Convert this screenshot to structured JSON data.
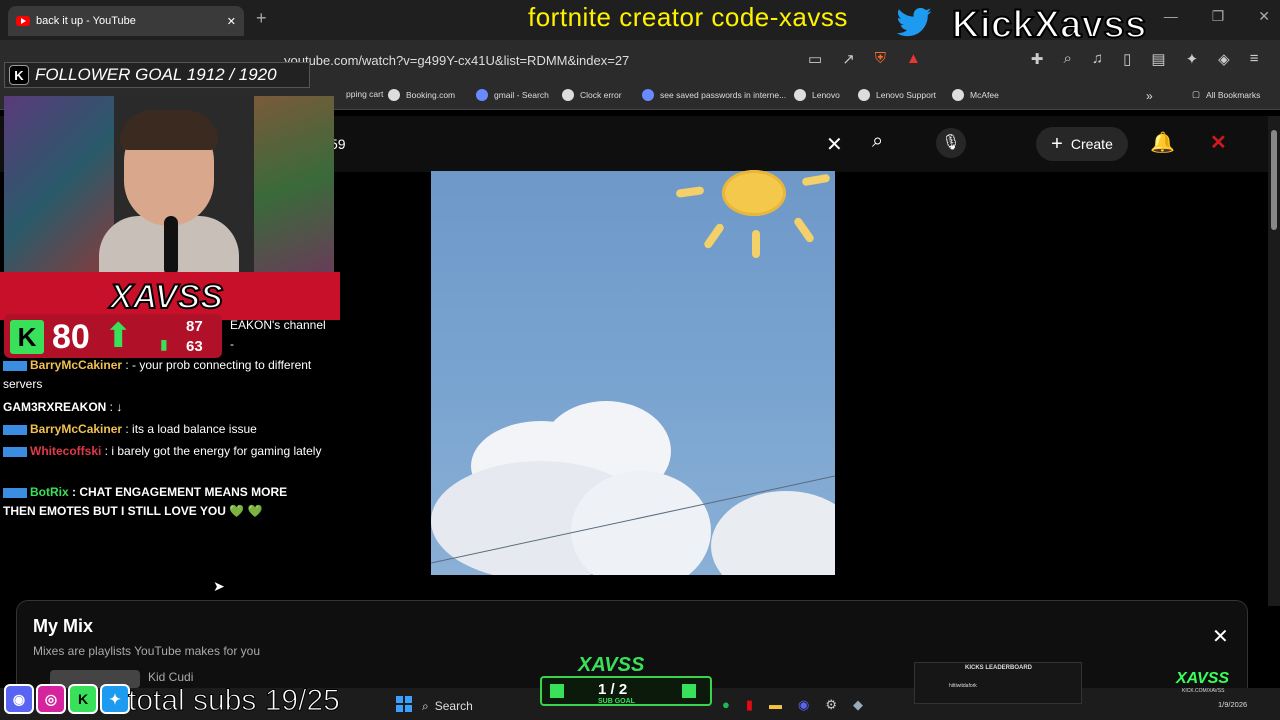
{
  "browser": {
    "tab_title": "back it up - YouTube",
    "new_tab": "+",
    "url": "youtube.com/watch?v=g499Y-cx41U&list=RDMM&index=27",
    "bookmarks": [
      "pping cart",
      "Booking.com",
      "gmail - Search",
      "Clock error",
      "see saved passwords in interne...",
      "Lenovo",
      "Lenovo Support",
      "McAfee"
    ],
    "all_bookmarks": "All Bookmarks",
    "window_controls": [
      "minimize-icon",
      "restore-icon",
      "close-icon"
    ]
  },
  "youtube": {
    "search_value": "59",
    "create_label": "Create",
    "mix": {
      "title": "My Mix",
      "subtitle": "Mixes are playlists YouTube makes for you",
      "first_item_artist": "Kid Cudi"
    }
  },
  "overlay": {
    "creator_code": "fortnite creator code-xavss",
    "kick_name": "KickXavss",
    "follower_goal": "FOLLOWER GOAL 1912 / 1920",
    "logo_text": "XAVSS",
    "stat_main": "80",
    "stat_top": "87",
    "stat_bottom": "63",
    "total_subs": "total subs 19/25",
    "sub_goal": "1 / 2",
    "sub_goal_label": "SUB GOAL",
    "leaderboard_title": "KICKS LEADERBOARD",
    "leaderboard_entry": "hittiwitdafork",
    "brand_small": "XAVSS",
    "brand_url": "KICK.COM/XAVSS"
  },
  "chat": [
    {
      "user": "",
      "text": "EAKON's channel -",
      "color": "#ffffff"
    },
    {
      "user": "BarryMcCakiner",
      "text": " : - your prob connecting to different servers",
      "color": "#f0c050"
    },
    {
      "user": "GAM3RXREAKON",
      "text": " : ↓",
      "color": "#ffffff"
    },
    {
      "user": "BarryMcCakiner",
      "text": " : its a load balance issue",
      "color": "#f0c050"
    },
    {
      "user": "Whitecoffski",
      "text": " : i barely got the energy for gaming lately",
      "color": "#e03a4a"
    },
    {
      "user": "BotRix",
      "text": " : CHAT ENGAGEMENT MEANS MORE THEN EMOTES BUT I STILL LOVE YOU 💚 💚",
      "color": "#39e05a"
    }
  ],
  "taskbar": {
    "search_label": "Search",
    "date": "1/9/2026"
  }
}
